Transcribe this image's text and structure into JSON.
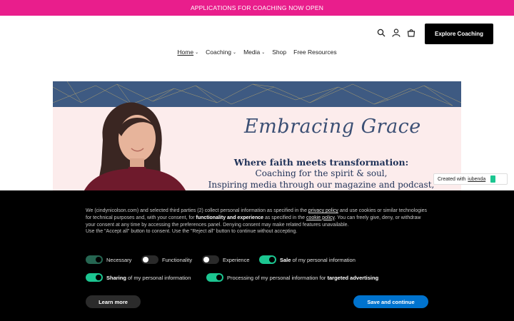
{
  "announcement": "APPLICATIONS FOR COACHING NOW OPEN",
  "header": {
    "explore_label": "Explore Coaching",
    "icons": [
      "search-icon",
      "account-icon",
      "cart-icon"
    ]
  },
  "nav": {
    "items": [
      {
        "label": "Home",
        "dropdown": true
      },
      {
        "label": "Coaching",
        "dropdown": true
      },
      {
        "label": "Media",
        "dropdown": true
      },
      {
        "label": "Shop",
        "dropdown": false
      },
      {
        "label": "Free Resources",
        "dropdown": false
      }
    ]
  },
  "banner": {
    "title": "Embracing Grace",
    "tagline": "Where faith meets transformation:",
    "line1": "Coaching for the spirit & soul,",
    "line2": "Inspiring media through our magazine and podcast,"
  },
  "iubenda": {
    "prefix": "Created with",
    "brand": "iubenda"
  },
  "cookie": {
    "p1_a": "We (cindynicolson.com) and selected third parties (2) collect personal information as specified in the ",
    "privacy_link": "privacy policy",
    "p1_b": " and use cookies or similar technologies for technical purposes and, with your consent, for ",
    "bold1": "functionality and experience",
    "p1_c": " as specified in the ",
    "cookie_link": "cookie policy",
    "p1_d": ". You can freely give, deny, or withdraw your consent at any time by accessing the preferences panel. Denying consent may make related features unavailable.",
    "p2": "Use the \"Accept all\" button to consent. Use the \"Reject all\" button to continue without accepting.",
    "toggles": {
      "necessary": "Necessary",
      "functionality": "Functionality",
      "experience": "Experience",
      "sale_bold": "Sale",
      "sale_rest": " of my personal information",
      "sharing_bold": "Sharing",
      "sharing_rest": " of my personal information",
      "targeted_pre": "Processing of my personal information for ",
      "targeted_bold": "targeted advertising"
    },
    "learn_more": "Learn more",
    "save": "Save and continue"
  },
  "colors": {
    "announcement_bg": "#e91e8c",
    "toggle_on": "#1cc691",
    "save_button": "#0073ce"
  }
}
